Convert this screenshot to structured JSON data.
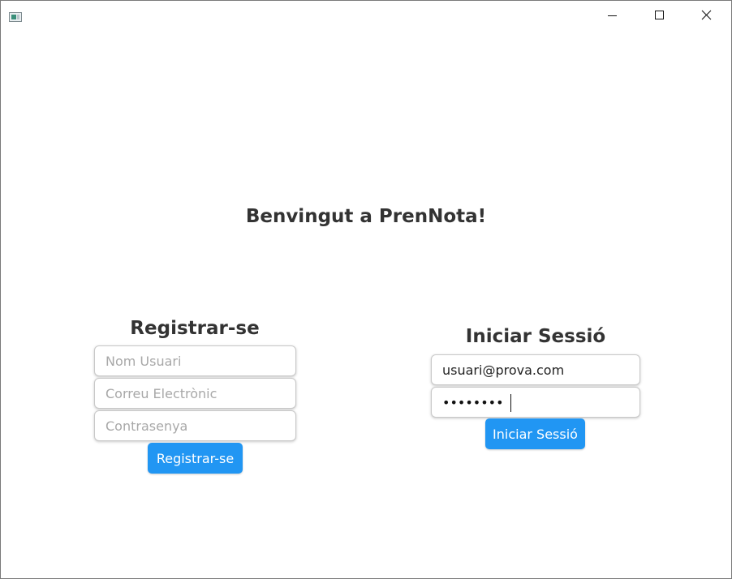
{
  "window": {
    "app_icon": "app-window-icon",
    "controls": {
      "minimize_icon": "minimize-icon",
      "maximize_icon": "maximize-icon",
      "close_icon": "close-icon"
    }
  },
  "welcome": {
    "title": "Benvingut a PrenNota!"
  },
  "register": {
    "title": "Registrar-se",
    "username_placeholder": "Nom Usuari",
    "email_placeholder": "Correu Electrònic",
    "password_placeholder": "Contrasenya",
    "button_label": "Registrar-se"
  },
  "login": {
    "title": "Iniciar Sessió",
    "email_value": "usuari@prova.com",
    "password_masked": "••••••••",
    "button_label": "Iniciar Sessió"
  },
  "colors": {
    "accent": "#2196f3",
    "heading": "#333333"
  }
}
